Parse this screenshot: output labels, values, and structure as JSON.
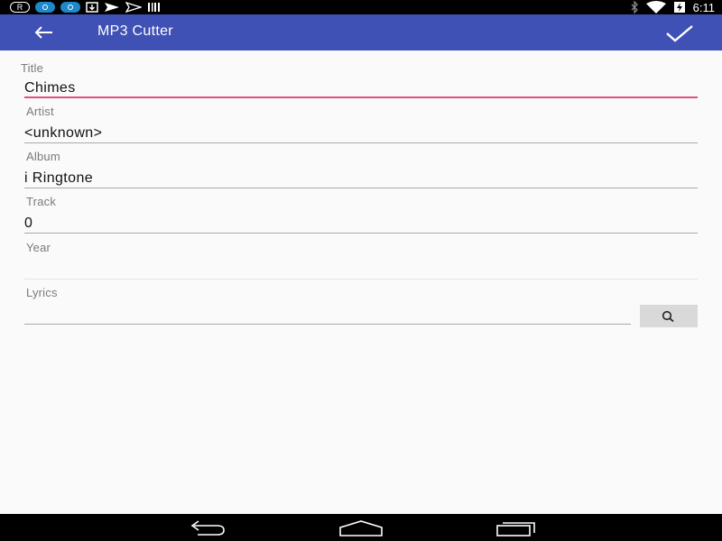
{
  "status_bar": {
    "time": "6:11",
    "left_icons": [
      "registered-icon",
      "drop-notification-icon",
      "drop-notification-icon",
      "download-icon",
      "send-icon",
      "send-icon",
      "barcode-icon"
    ],
    "right_icons": [
      "bluetooth-icon",
      "wifi-icon",
      "battery-charging-icon"
    ]
  },
  "app_bar": {
    "title": "MP3 Cutter"
  },
  "form": {
    "title": {
      "label": "Title",
      "value": "Chimes"
    },
    "artist": {
      "label": "Artist",
      "value": "<unknown>"
    },
    "album": {
      "label": "Album",
      "value": "i Ringtone"
    },
    "track": {
      "label": "Track",
      "value": "0"
    },
    "year": {
      "label": "Year",
      "value": ""
    },
    "lyrics": {
      "label": "Lyrics",
      "value": ""
    }
  },
  "colors": {
    "app_bar": "#3f51b5",
    "focused_underline": "#e04f86",
    "background": "#fafafa"
  }
}
